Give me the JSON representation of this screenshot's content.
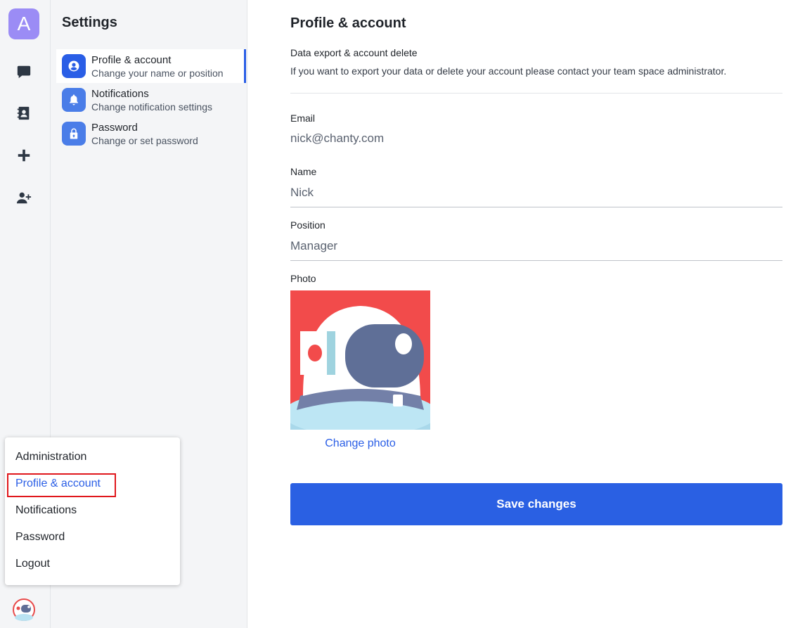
{
  "rail": {
    "workspace_initial": "A",
    "icons": [
      "chat-icon",
      "contacts-icon",
      "plus-icon",
      "add-user-icon"
    ]
  },
  "sidebar": {
    "title": "Settings",
    "items": [
      {
        "label": "Profile & account",
        "desc": "Change your name or position",
        "icon": "user-circle-icon",
        "active": true
      },
      {
        "label": "Notifications",
        "desc": "Change notification settings",
        "icon": "bell-icon",
        "active": false
      },
      {
        "label": "Password",
        "desc": "Change or set password",
        "icon": "lock-icon",
        "active": false
      }
    ]
  },
  "main": {
    "title": "Profile & account",
    "export_title": "Data export & account delete",
    "export_desc": "If you want to export your data or delete your account please contact your team space administrator.",
    "email_label": "Email",
    "email_value": "nick@chanty.com",
    "name_label": "Name",
    "name_value": "Nick",
    "position_label": "Position",
    "position_value": "Manager",
    "photo_label": "Photo",
    "change_photo": "Change photo",
    "save_label": "Save changes"
  },
  "menu": {
    "items": [
      {
        "label": "Administration",
        "active": false
      },
      {
        "label": "Profile & account",
        "active": true
      },
      {
        "label": "Notifications",
        "active": false
      },
      {
        "label": "Password",
        "active": false
      },
      {
        "label": "Logout",
        "active": false
      }
    ]
  },
  "colors": {
    "accent": "#2a5ee6",
    "highlight": "#e0171c",
    "workspace": "#9b8cf5"
  }
}
